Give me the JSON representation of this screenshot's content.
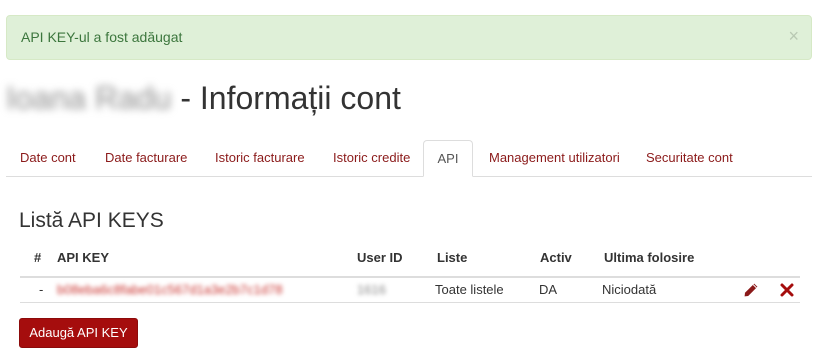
{
  "alert": {
    "message": "API KEY-ul a fost adăugat",
    "close_symbol": "×"
  },
  "page": {
    "owner_name": "Ioana Radu",
    "title_suffix": " - Informații cont"
  },
  "tabs": [
    {
      "label": "Date cont",
      "active": false
    },
    {
      "label": "Date facturare",
      "active": false
    },
    {
      "label": "Istoric facturare",
      "active": false
    },
    {
      "label": "Istoric credite",
      "active": false
    },
    {
      "label": "API",
      "active": true
    },
    {
      "label": "Management utilizatori",
      "active": false
    },
    {
      "label": "Securitate cont",
      "active": false
    }
  ],
  "section": {
    "title": "Listă API KEYS"
  },
  "table": {
    "headers": [
      "#",
      "API KEY",
      "User ID",
      "Liste",
      "Activ",
      "Ultima folosire"
    ],
    "rows": [
      {
        "index": "-",
        "api_key": "b08eba6c8fabe01c567d1a3e2b7c1d78",
        "user_id": "1616",
        "lists": "Toate listele",
        "active": "DA",
        "last_used": "Niciodată"
      }
    ]
  },
  "actions": {
    "add_button_label": "Adaugă API KEY"
  },
  "colors": {
    "brand": "#a50d0d",
    "link": "#8b1a1a",
    "success_bg": "#dff0d8",
    "success_text": "#3c763d"
  },
  "icons": {
    "edit": "pencil-icon",
    "delete": "delete-x-icon",
    "close": "close-icon"
  }
}
